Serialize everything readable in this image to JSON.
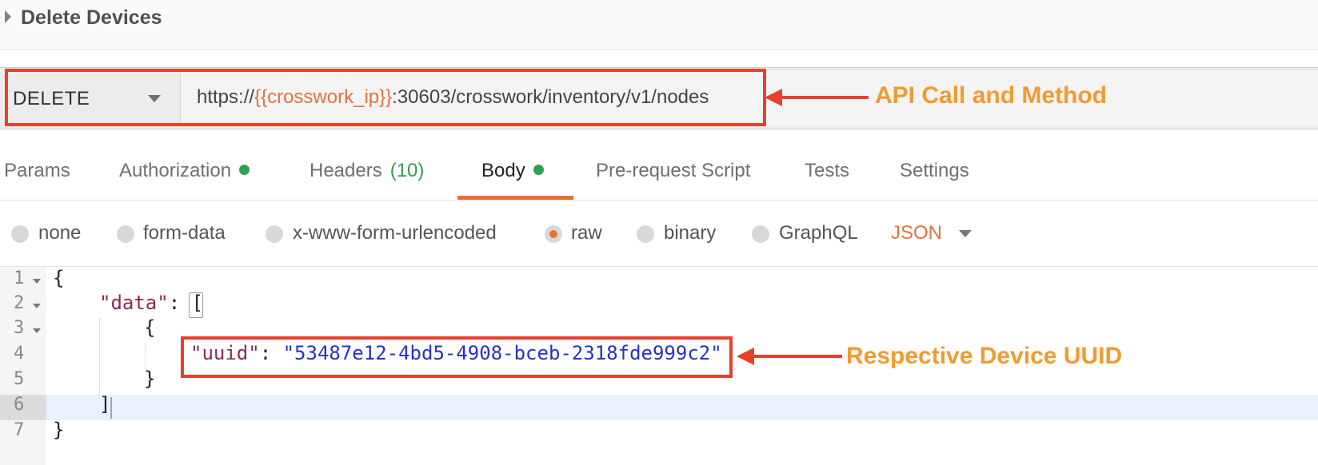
{
  "request": {
    "title": "Delete Devices",
    "method": "DELETE",
    "url": {
      "prefix": "https://",
      "variable": "{{crosswork_ip}}",
      "suffix": ":30603/crosswork/inventory/v1/nodes"
    }
  },
  "tabs": [
    {
      "label": "Params"
    },
    {
      "label": "Authorization",
      "dot": true
    },
    {
      "label": "Headers",
      "count": "(10)"
    },
    {
      "label": "Body",
      "dot": true,
      "active": true
    },
    {
      "label": "Pre-request Script"
    },
    {
      "label": "Tests"
    },
    {
      "label": "Settings"
    }
  ],
  "body_types": {
    "options": [
      "none",
      "form-data",
      "x-www-form-urlencoded",
      "raw",
      "binary",
      "GraphQL"
    ],
    "selected": "raw",
    "format": "JSON"
  },
  "code": {
    "line_numbers": [
      "1",
      "2",
      "3",
      "4",
      "5",
      "6",
      "7"
    ],
    "lines": {
      "l1": "{",
      "l2_key": "\"data\"",
      "l2_rest": ": [",
      "l3": "{",
      "l4_key": "\"uuid\"",
      "l4_colon": ": ",
      "l4_value": "\"53487e12-4bd5-4908-bceb-2318fde999c2\"",
      "l5": "}",
      "l6": "]",
      "l7": "}"
    }
  },
  "annotations": {
    "api_call": "API Call and Method",
    "device_uuid": "Respective Device UUID"
  },
  "colors": {
    "accent": "#e5713a",
    "annotation_box": "#e8402b",
    "annotation_text": "#f39a2f",
    "status_dot": "#30a14e"
  }
}
